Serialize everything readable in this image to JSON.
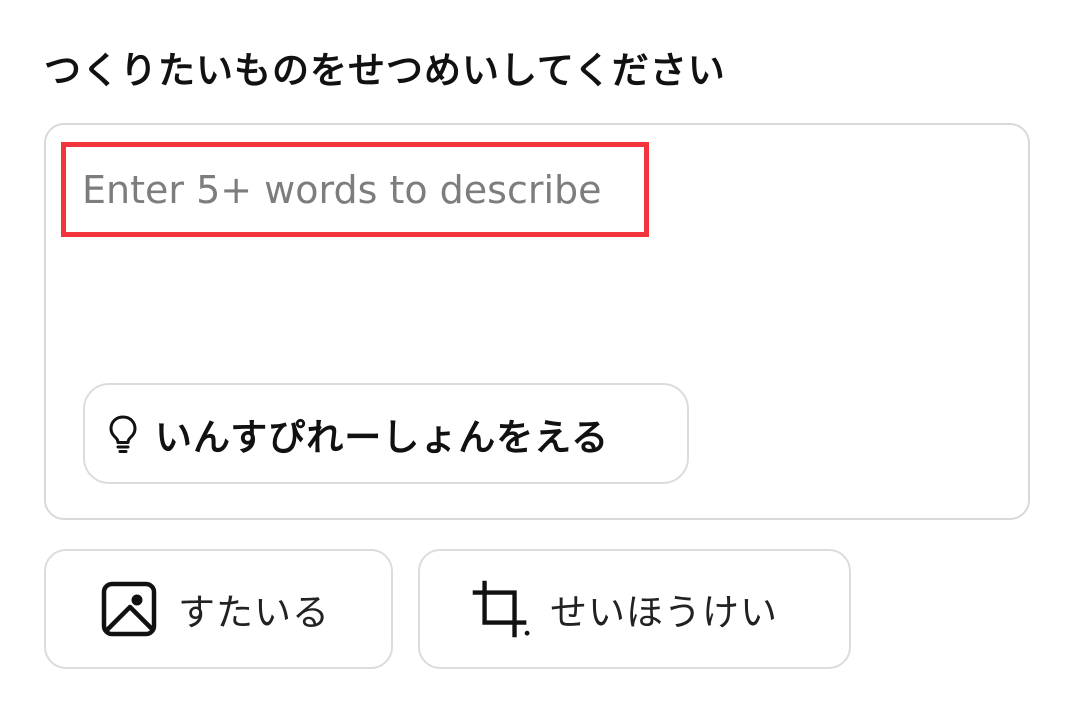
{
  "prompt": {
    "title": "つくりたいものをせつめいしてください",
    "placeholder": "Enter 5+ words to describe",
    "value": ""
  },
  "inspiration_button": {
    "icon": "lightbulb-icon",
    "label": "いんすぴれーしょんをえる"
  },
  "options": {
    "style": {
      "icon": "image-icon",
      "label": "すたいる"
    },
    "aspect_ratio": {
      "icon": "crop-icon",
      "label": "せいほうけい"
    }
  },
  "colors": {
    "highlight": "#f2353d",
    "border": "#d9d9dc",
    "placeholder": "#7d7d80",
    "text": "#111111"
  }
}
